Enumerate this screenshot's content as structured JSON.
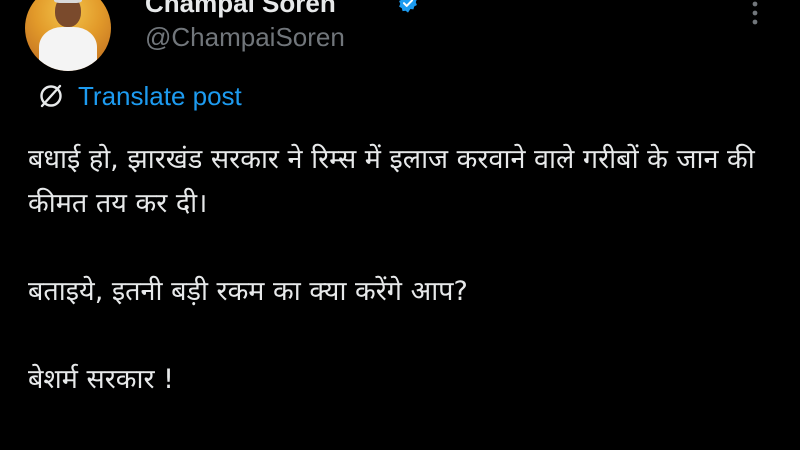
{
  "author": {
    "display_name": "Champai Soren",
    "handle": "@ChampaiSoren",
    "verified_icon": "verified-badge-icon",
    "avatar_icon": "avatar"
  },
  "header": {
    "more_icon": "more-options-icon"
  },
  "translate": {
    "icon": "translate-globe-icon",
    "label": "Translate post"
  },
  "post": {
    "paragraphs": [
      "बधाई हो, झारखंड सरकार ने रिम्स में इलाज करवाने वाले गरीबों के जान की कीमत तय कर दी।",
      "बताइये, इतनी बड़ी रकम का क्या करेंगे आप?",
      "बेशर्म सरकार !"
    ]
  },
  "colors": {
    "background": "#000000",
    "text_primary": "#e7e9ea",
    "text_secondary": "#71767b",
    "link": "#1d9bf0",
    "verified": "#1d9bf0"
  }
}
